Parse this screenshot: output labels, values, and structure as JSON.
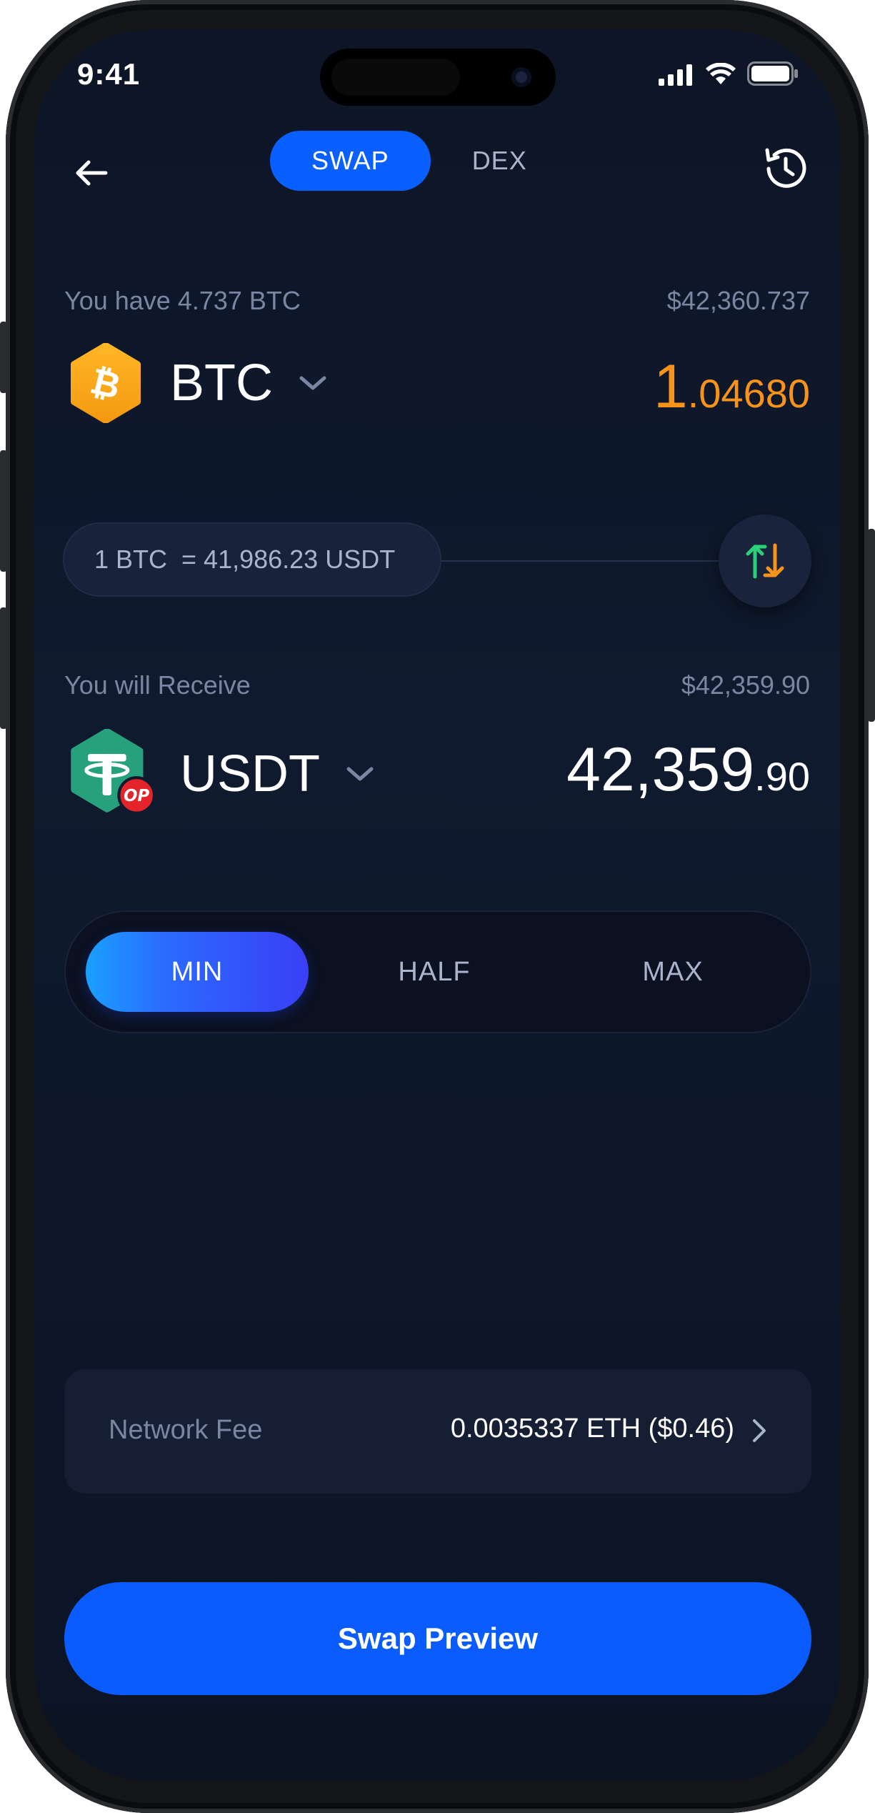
{
  "status": {
    "time": "9:41"
  },
  "header": {
    "tabs": [
      {
        "label": "SWAP",
        "active": true
      },
      {
        "label": "DEX",
        "active": false
      }
    ]
  },
  "from": {
    "balance_label": "You have 4.737 BTC",
    "fiat_value": "$42,360.737",
    "coin": "BTC",
    "amount_int": "1",
    "amount_dec": ".04680",
    "icon": "bitcoin-icon",
    "color": "#f7931a"
  },
  "rate": {
    "text": "1 BTC  = 41,986.23 USDT"
  },
  "to": {
    "label": "You will Receive",
    "fiat_value": "$42,359.90",
    "coin": "USDT",
    "amount_int": "42,359",
    "amount_dec": ".90",
    "icon": "tether-icon",
    "badge": "OP",
    "color": "#26a17b",
    "badge_color": "#e3242b"
  },
  "presets": [
    {
      "label": "MIN",
      "active": true
    },
    {
      "label": "HALF",
      "active": false
    },
    {
      "label": "MAX",
      "active": false
    }
  ],
  "fee": {
    "label": "Network Fee",
    "value": "0.0035337 ETH ($0.46)"
  },
  "cta": {
    "label": "Swap Preview"
  },
  "colors": {
    "accent": "#0a5cff",
    "background": "#0d1526"
  }
}
